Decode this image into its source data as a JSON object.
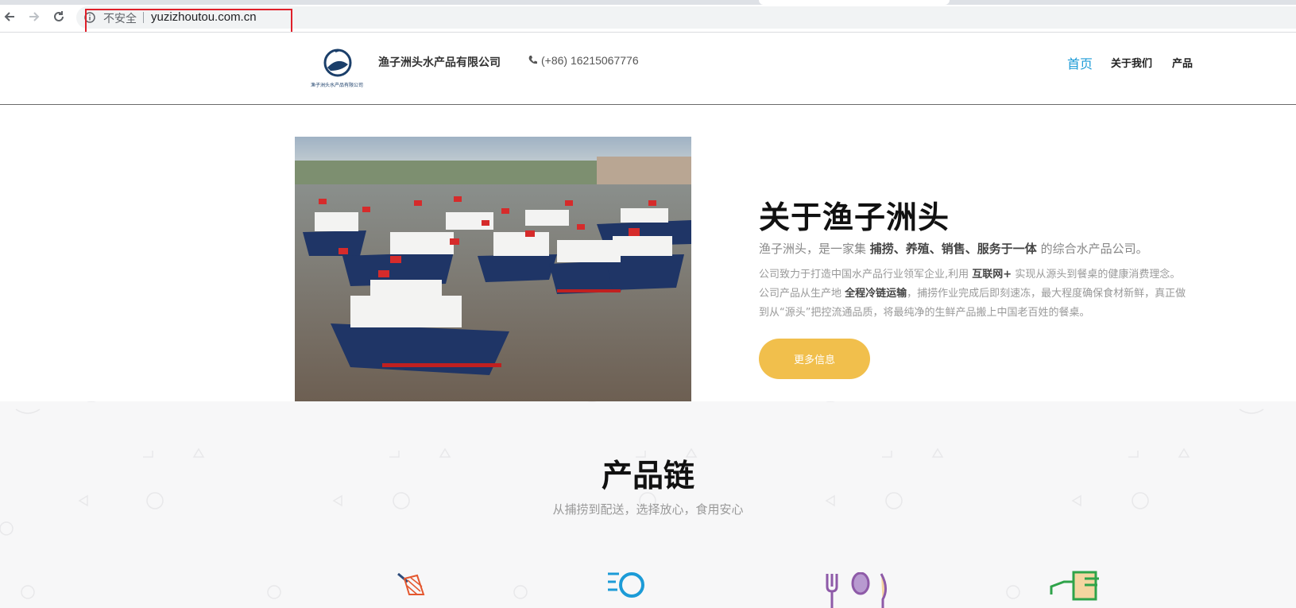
{
  "browser": {
    "security_label": "不安全",
    "url": "yuzizhoutou.com.cn",
    "icons": [
      "back-arrow-icon",
      "forward-arrow-icon",
      "reload-icon",
      "info-icon"
    ]
  },
  "header": {
    "company_name": "渔子洲头水产品有限公司",
    "phone": "(+86) 16215067776",
    "logo_caption": "渔子洲头水产品有限公司",
    "nav": [
      {
        "label": "首页",
        "active": true
      },
      {
        "label": "关于我们",
        "active": false
      },
      {
        "label": "产品",
        "active": false
      }
    ],
    "accent_color": "#1c9bd7"
  },
  "about": {
    "title": "关于渔子洲头",
    "lead_prefix": "渔子洲头，是一家集",
    "lead_bold": "捕捞、养殖、销售、服务于一体",
    "lead_suffix": "的综合水产品公司。",
    "desc_1": "公司致力于打造中国水产品行业领军企业,利用",
    "desc_bold_1": "互联网+",
    "desc_2": "实现从源头到餐桌的健康消费理念。 公司产品从生产地",
    "desc_bold_2": "全程冷链运输",
    "desc_3": "，捕捞作业完成后即刻速冻，最大程度确保食材新鲜，真正做到从“源头”把控流通品质，将最纯净的生鲜产品搬上中国老百姓的餐桌。",
    "button_label": "更多信息",
    "button_color": "#f1bf4c"
  },
  "chain": {
    "title": "产品链",
    "subtitle": "从捕捞到配送，选择放心，食用安心",
    "icons": [
      "fishing-net-icon",
      "search-icon",
      "cutlery-icon",
      "delivery-truck-icon"
    ]
  }
}
